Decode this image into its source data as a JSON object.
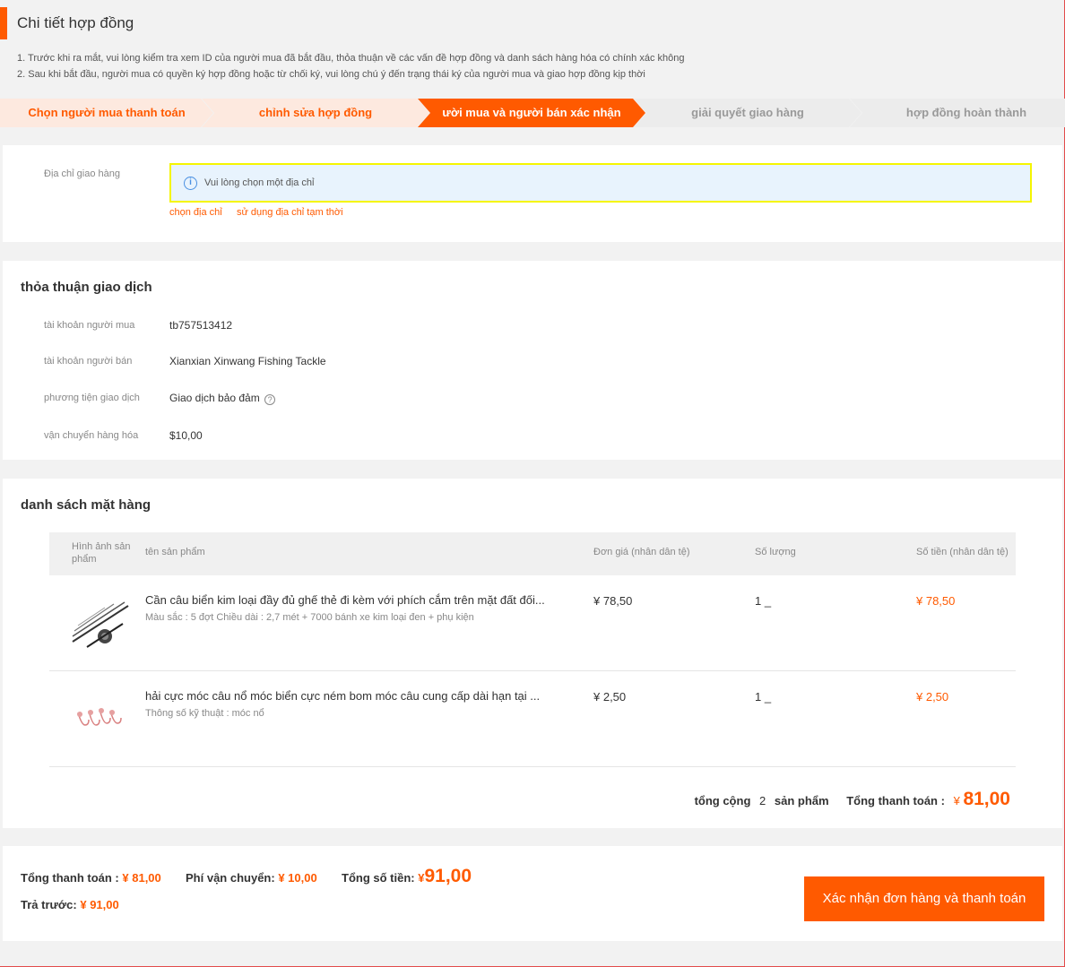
{
  "page_title": "Chi tiết hợp đồng",
  "notes": [
    "1. Trước khi ra mắt, vui lòng kiểm tra xem ID của người mua đã bắt đầu, thỏa thuận về các vấn đề hợp đồng và danh sách hàng hóa có chính xác không",
    "2. Sau khi bắt đầu, người mua có quyền ký hợp đồng hoặc từ chối ký, vui lòng chú ý đến trạng thái ký của người mua và giao hợp đồng kịp thời"
  ],
  "steps": [
    {
      "label": "Chọn người mua thanh toán",
      "state": "done"
    },
    {
      "label": "chỉnh sửa hợp đồng",
      "state": "done"
    },
    {
      "label": "ười mua và người bán xác nhận",
      "state": "active"
    },
    {
      "label": "giải quyết giao hàng",
      "state": "pending"
    },
    {
      "label": "hợp đồng hoàn thành",
      "state": "pending"
    }
  ],
  "address": {
    "label": "Địa chỉ giao hàng",
    "notice": "Vui lòng chọn một địa chỉ",
    "choose_link": "chọn địa chỉ",
    "temp_link": "sử dụng địa chỉ tạm thời"
  },
  "agreement": {
    "title": "thỏa thuận giao dịch",
    "rows": [
      {
        "label": "tài khoản người mua",
        "value": "tb757513412"
      },
      {
        "label": "tài khoản người bán",
        "value": "Xianxian Xinwang Fishing Tackle"
      },
      {
        "label": "phương tiện giao dịch",
        "value": "Giao dịch bảo đảm"
      },
      {
        "label": "vận chuyển hàng hóa",
        "value": "$10,00"
      }
    ]
  },
  "items": {
    "title": "danh sách mặt hàng",
    "headers": {
      "image_line1": "Hình ảnh sản",
      "image_line2": "phẩm",
      "name": "tên sản phẩm",
      "unit_price": "Đơn giá (nhân dân tệ)",
      "quantity": "Số lượng",
      "amount": "Số tiền (nhân dân tệ)"
    },
    "rows": [
      {
        "name": "Cần câu biển kim loại đầy đủ ghế thẻ đi kèm với phích cắm trên mặt đất đối...",
        "spec": "Màu sắc : 5 đợt Chiều dài : 2,7 mét + 7000 bánh xe kim loại đen + phụ kiện",
        "price": "¥ 78,50",
        "qty": "1 _",
        "amount": "¥ 78,50",
        "thumb_icon": "fishing-rod-icon"
      },
      {
        "name": "hải cực móc câu nổ móc biển cực ném bom móc câu cung cấp dài hạn tại ...",
        "spec": "Thông số kỹ thuật : móc nổ",
        "price": "¥ 2,50",
        "qty": "1 _",
        "amount": "¥ 2,50",
        "thumb_icon": "fishing-hook-icon"
      }
    ],
    "summary": {
      "total_label": "tổng cộng",
      "count": "2",
      "unit": "sản phẩm",
      "pay_label": "Tổng thanh toán :",
      "currency": "¥",
      "pay_value": "81,00"
    }
  },
  "footer": {
    "total_label": "Tổng thanh toán :",
    "total_value": "¥ 81,00",
    "ship_label": "Phí vận chuyển:",
    "ship_value": "¥ 10,00",
    "sum_label": "Tổng số tiền:",
    "sum_currency": "¥",
    "sum_value": "91,00",
    "prepay_label": "Trả trước:",
    "prepay_value": "¥ 91,00",
    "confirm_button": "Xác nhận đơn hàng và thanh toán"
  },
  "colors": {
    "accent": "#ff5a00",
    "step_done_bg": "#fde9df",
    "step_pending_bg": "#ececec",
    "notice_bg": "#e8f3fd",
    "notice_border": "#f5f500"
  }
}
